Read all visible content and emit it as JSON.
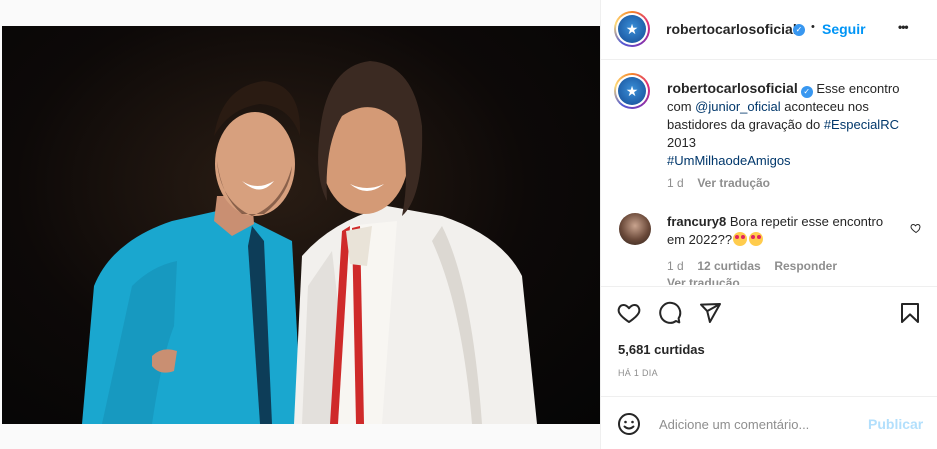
{
  "post": {
    "author": "robertocarlosoficial",
    "follow_label": "Seguir",
    "separator": "•",
    "more_label": "•••"
  },
  "caption": {
    "author": "robertocarlosoficial",
    "text_1": "Esse encontro com ",
    "mention": "@junior_oficial",
    "text_2": " aconteceu nos bastidores da gravação do ",
    "hashtag_1": "#EspecialRC",
    "text_3": " 2013",
    "hashtag_2": "#UmMilhaodeAmigos",
    "time": "1 d",
    "translate_label": "Ver tradução"
  },
  "comments": [
    {
      "author": "francury8",
      "text": "Bora repetir esse encontro em 2022??",
      "time": "1 d",
      "likes": "12 curtidas",
      "reply_label": "Responder",
      "translate_label": "Ver tradução"
    }
  ],
  "stats": {
    "likes": "5,681 curtidas",
    "posted_ago": "HÁ 1 DIA"
  },
  "composer": {
    "placeholder": "Adicione um comentário...",
    "publish_label": "Publicar"
  },
  "colors": {
    "accent": "#0095f6",
    "link": "#00376b",
    "muted": "#8e8e8e",
    "border": "#efefef"
  },
  "icons": [
    "heart-icon",
    "comment-icon",
    "share-icon",
    "bookmark-icon",
    "emoji-icon",
    "verified-icon",
    "more-icon"
  ]
}
